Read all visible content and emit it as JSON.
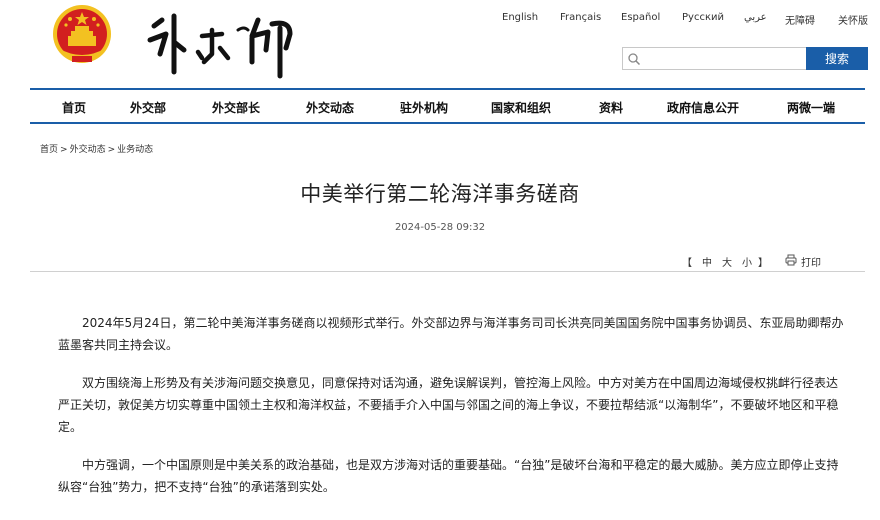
{
  "languages": [
    "English",
    "Français",
    "Español",
    "Русский",
    "عربي",
    "无障碍",
    "关怀版"
  ],
  "search": {
    "value": "",
    "placeholder": "",
    "button_label": "搜索"
  },
  "nav": [
    "首页",
    "外交部",
    "外交部长",
    "外交动态",
    "驻外机构",
    "国家和组织",
    "资料",
    "政府信息公开",
    "两微一端"
  ],
  "breadcrumb": [
    "首页",
    "外交动态",
    "业务动态"
  ],
  "breadcrumb_sep": ">",
  "article": {
    "title": "中美举行第二轮海洋事务磋商",
    "date": "2024-05-28 09:32",
    "tools": {
      "open": "【",
      "large": "中",
      "medium": "大",
      "small": "小",
      "close": "】",
      "print": "打印"
    },
    "paragraphs": [
      "2024年5月24日，第二轮中美海洋事务磋商以视频形式举行。外交部边界与海洋事务司司长洪亮同美国国务院中国事务协调员、东亚局助卿帮办蓝墨客共同主持会议。",
      "双方围绕海上形势及有关涉海问题交换意见，同意保持对话沟通，避免误解误判，管控海上风险。中方对美方在中国周边海域侵权挑衅行径表达严正关切，敦促美方切实尊重中国领土主权和海洋权益，不要插手介入中国与邻国之间的海上争议，不要拉帮结派“以海制华”，不要破坏地区和平稳定。",
      "中方强调，一个中国原则是中美关系的政治基础，也是双方涉海对话的重要基础。“台独”是破坏台海和平稳定的最大威胁。美方应立即停止支持纵容“台独”势力，把不支持“台独”的承诺落到实处。"
    ]
  },
  "colors": {
    "accent": "#1a5ea8",
    "emblem_red": "#d21f1f",
    "emblem_gold": "#f3c121"
  },
  "icons": [
    "national-emblem-icon",
    "search-icon",
    "print-icon"
  ]
}
